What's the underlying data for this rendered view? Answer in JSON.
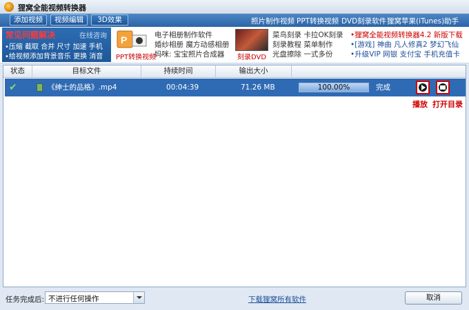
{
  "app": {
    "title": "狸窝全能视频转换器"
  },
  "toolbar": {
    "tabs": [
      "添加视频",
      "视频编辑",
      "3D效果"
    ],
    "links": [
      "照片制作视频",
      "PPT转换视频",
      "DVD刻录软件",
      "狸窝苹果(iTunes)助手"
    ]
  },
  "promo": {
    "faq_title": "常见问题解决",
    "faq_online": "在线咨询",
    "faq_line1": "•压缩 截取 合并 尺寸 加速 手机",
    "faq_line2": "•给视频添加背景音乐 更换 消音",
    "ppt_label": "PPT转换视频",
    "col1": [
      "电子相册制作软件",
      "婚纱相册 魔方动感相册",
      "妈咪: 宝宝照片合成器"
    ],
    "dvd_label": "刻录DVD",
    "col2": [
      "菜鸟刻录 卡拉OK刻录",
      "刻录教程 菜单制作",
      "光盘擦除 一式多份"
    ],
    "col3_line1": "•狸窝全能视频转换器4.2 新版下载",
    "col3_line2": "•[游戏] 神曲 凡人修真2 梦幻飞仙",
    "col3_line3": "•升级VIP 网银 支付宝 手机充值卡"
  },
  "table": {
    "columns": [
      "状态",
      "目标文件",
      "持续时间",
      "输出大小"
    ],
    "rows": [
      {
        "file": "《绅士的品格》.mp4",
        "duration": "00:04:39",
        "size": "71.26 MB",
        "progress_pct": 100,
        "progress_text": "100.00%",
        "status": "完成"
      }
    ]
  },
  "actions": {
    "play_label": "播放",
    "open_dir_label": "打开目录"
  },
  "bottom": {
    "after_label": "任务完成后:",
    "after_value": "不进行任何操作",
    "download_link": "下载狸窝所有软件",
    "cancel_label": "取消"
  },
  "colors": {
    "selection": "#2f6bb4",
    "accent_red": "#d00000"
  }
}
